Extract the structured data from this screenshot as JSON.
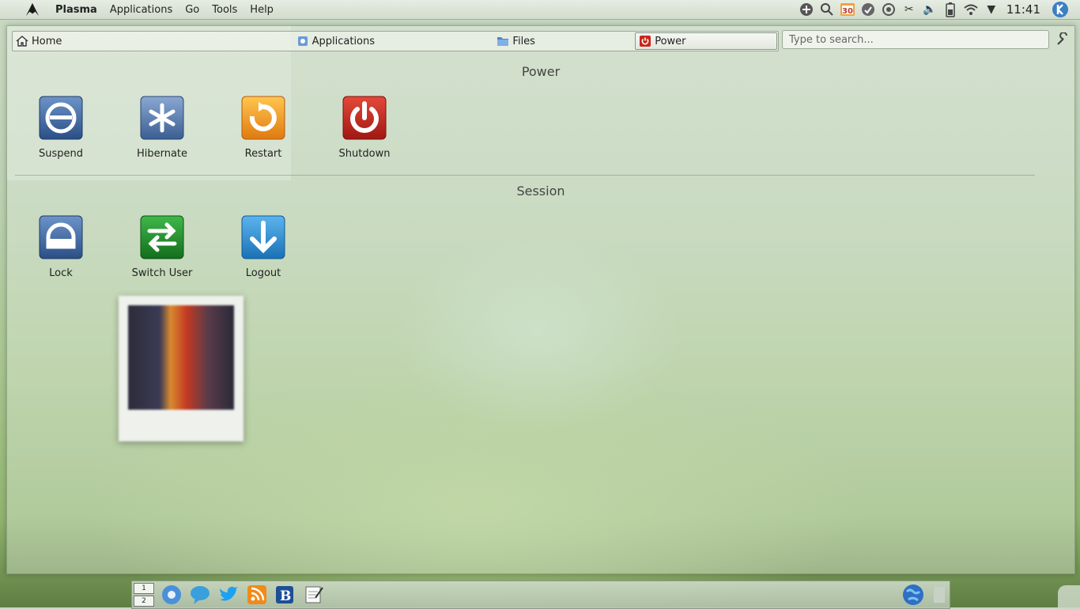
{
  "top_panel": {
    "menu": [
      "Plasma",
      "Applications",
      "Go",
      "Tools",
      "Help"
    ],
    "calendar_day": "30",
    "clock": "11:41"
  },
  "launcher": {
    "tabs": [
      {
        "label": "Home",
        "icon": "home-icon"
      },
      {
        "label": "Applications",
        "icon": "applications-icon"
      },
      {
        "label": "Files",
        "icon": "folder-icon"
      },
      {
        "label": "Power",
        "icon": "power-icon"
      }
    ],
    "active_tab": "Power",
    "search_placeholder": "Type to search...",
    "sections": [
      {
        "title": "Power",
        "items": [
          {
            "label": "Suspend",
            "icon": "suspend-icon"
          },
          {
            "label": "Hibernate",
            "icon": "hibernate-icon"
          },
          {
            "label": "Restart",
            "icon": "restart-icon"
          },
          {
            "label": "Shutdown",
            "icon": "shutdown-icon"
          }
        ]
      },
      {
        "title": "Session",
        "items": [
          {
            "label": "Lock",
            "icon": "lock-icon"
          },
          {
            "label": "Switch User",
            "icon": "switch-user-icon"
          },
          {
            "label": "Logout",
            "icon": "logout-icon"
          }
        ]
      }
    ]
  },
  "dock": {
    "pager": [
      "1",
      "2"
    ],
    "icons": [
      "chromium-icon",
      "chat-icon",
      "twitter-icon",
      "rss-icon",
      "blogilo-icon",
      "notes-icon",
      "globe-icon"
    ]
  },
  "colors": {
    "accent_blue": "#3b6aa8",
    "power_red": "#c8261c",
    "restart_orange": "#f0a018",
    "switch_green": "#1f8d2a",
    "logout_blue": "#2d8fd0"
  }
}
